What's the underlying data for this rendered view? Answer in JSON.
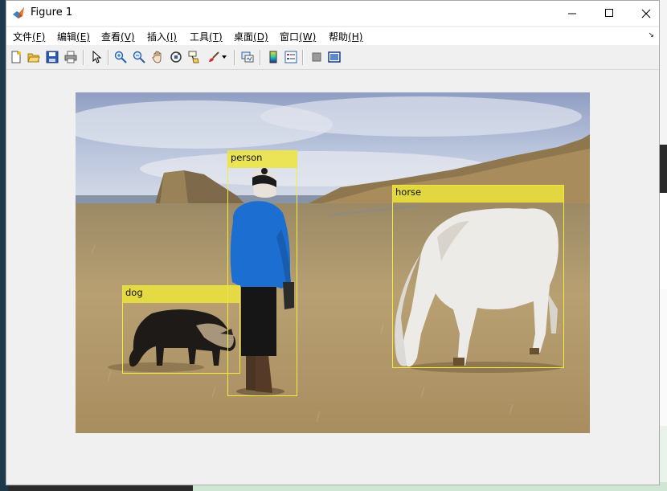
{
  "window": {
    "title": "Figure 1",
    "minimize_symbol": "—",
    "maximize_symbol": "☐",
    "close_symbol": "✕"
  },
  "menubar": {
    "items": [
      {
        "label": "文件",
        "key": "(F)"
      },
      {
        "label": "编辑",
        "key": "(E)"
      },
      {
        "label": "查看",
        "key": "(V)"
      },
      {
        "label": "插入",
        "key": "(I)"
      },
      {
        "label": "工具",
        "key": "(T)"
      },
      {
        "label": "桌面",
        "key": "(D)"
      },
      {
        "label": "窗口",
        "key": "(W)"
      },
      {
        "label": "帮助",
        "key": "(H)"
      }
    ],
    "overflow_icon": "dock-arrow-icon"
  },
  "toolbar": {
    "buttons": [
      "new-figure-icon",
      "open-file-icon",
      "save-icon",
      "print-icon",
      "edit-plot-icon",
      "zoom-in-icon",
      "zoom-out-icon",
      "pan-icon",
      "rotate-3d-icon",
      "data-cursor-icon",
      "brush-icon",
      "brush-dropdown-icon",
      "link-plot-icon",
      "insert-colorbar-icon",
      "insert-legend-icon",
      "hide-plot-tools-icon",
      "show-plot-tools-icon"
    ]
  },
  "detections": [
    {
      "label": "person"
    },
    {
      "label": "dog"
    },
    {
      "label": "horse"
    }
  ],
  "colors": {
    "box": "#f2ec3a",
    "label_bg": "#ece43c",
    "sky": "#a9b7d2",
    "grass": "#b49a6c"
  }
}
